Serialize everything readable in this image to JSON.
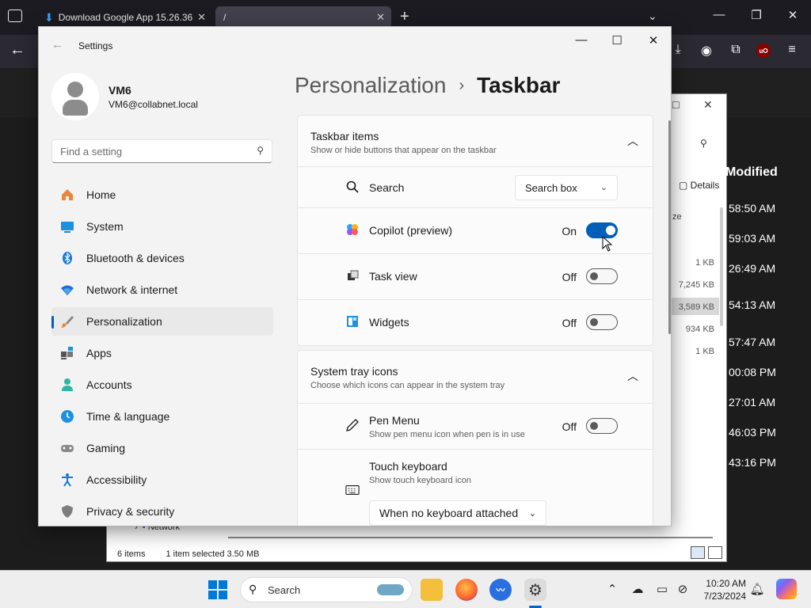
{
  "browser": {
    "tabs": [
      {
        "label": "Download Google App 15.26.36",
        "close": "✕"
      },
      {
        "label": "/",
        "close": "✕"
      }
    ],
    "new_tab": "+",
    "overflow": "⌄",
    "win_controls": {
      "minimize": "—",
      "maximize": "❐",
      "close": "✕"
    },
    "back": "←"
  },
  "explorer": {
    "header_modified": "Modified",
    "details_label": "Details",
    "times": [
      "58:50 AM",
      "59:03 AM",
      "26:49 AM",
      "54:13 AM",
      "57:47 AM",
      "00:08 PM",
      "27:01 AM",
      "46:03 PM",
      "43:16 PM"
    ],
    "sizes": [
      "1 KB",
      "7,245 KB",
      "3,589 KB",
      "934 KB",
      "1 KB"
    ],
    "nav_item": "Network",
    "partial_text": "ze",
    "status": {
      "items": "6 items",
      "selected": "1 item selected  3.50 MB"
    }
  },
  "settings": {
    "window_title": "Settings",
    "back_glyph": "←",
    "controls": {
      "minimize": "—",
      "maximize": "☐",
      "close": "✕"
    },
    "account": {
      "name": "VM6",
      "email": "VM6@collabnet.local"
    },
    "search_placeholder": "Find a setting",
    "nav": [
      {
        "label": "Home",
        "icon": "home-icon"
      },
      {
        "label": "System",
        "icon": "system-icon"
      },
      {
        "label": "Bluetooth & devices",
        "icon": "bluetooth-icon"
      },
      {
        "label": "Network & internet",
        "icon": "wifi-icon"
      },
      {
        "label": "Personalization",
        "icon": "brush-icon",
        "active": true
      },
      {
        "label": "Apps",
        "icon": "apps-icon"
      },
      {
        "label": "Accounts",
        "icon": "person-icon"
      },
      {
        "label": "Time & language",
        "icon": "globe-clock-icon"
      },
      {
        "label": "Gaming",
        "icon": "gamepad-icon"
      },
      {
        "label": "Accessibility",
        "icon": "accessibility-icon"
      },
      {
        "label": "Privacy & security",
        "icon": "shield-icon"
      }
    ],
    "breadcrumb": {
      "parent": "Personalization",
      "separator": "›",
      "current": "Taskbar"
    },
    "taskbar_items": {
      "title": "Taskbar items",
      "subtitle": "Show or hide buttons that appear on the taskbar",
      "search": {
        "label": "Search",
        "value": "Search box"
      },
      "copilot": {
        "label": "Copilot (preview)",
        "state": "On",
        "on": true
      },
      "task_view": {
        "label": "Task view",
        "state": "Off",
        "on": false
      },
      "widgets": {
        "label": "Widgets",
        "state": "Off",
        "on": false
      }
    },
    "system_tray": {
      "title": "System tray icons",
      "subtitle": "Choose which icons can appear in the system tray",
      "pen_menu": {
        "label": "Pen Menu",
        "sub": "Show pen menu icon when pen is in use",
        "state": "Off",
        "on": false
      },
      "touch_keyboard": {
        "label": "Touch keyboard",
        "sub": "Show touch keyboard icon",
        "value": "When no keyboard attached"
      }
    }
  },
  "taskbar": {
    "search_label": "Search",
    "time": "10:20 AM",
    "date": "7/23/2024",
    "colors": {
      "accent": "#0078d4"
    }
  }
}
